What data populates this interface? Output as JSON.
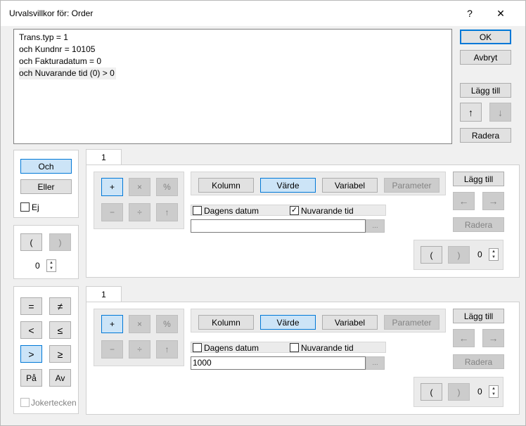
{
  "window": {
    "title": "Urvalsvillkor för: Order",
    "help": "?",
    "close": "✕"
  },
  "conditions": [
    "Trans.typ = 1",
    "och Kundnr = 10105",
    "och Fakturadatum = 0",
    "och Nuvarande tid (0) > 0"
  ],
  "right_buttons": {
    "ok": "OK",
    "cancel": "Avbryt",
    "add": "Lägg till",
    "up": "↑",
    "down": "↓",
    "delete": "Radera"
  },
  "logic": {
    "and": "Och",
    "or": "Eller",
    "not": "Ej"
  },
  "paren_group": {
    "open": "(",
    "close": ")",
    "count": "0"
  },
  "operators": {
    "eq": "=",
    "neq": "≠",
    "lt": "<",
    "lte": "≤",
    "gt": ">",
    "gte": "≥",
    "on": "På",
    "off": "Av",
    "wildcard": "Jokertecken"
  },
  "editors": [
    {
      "tab": "1",
      "ops": {
        "plus": "+",
        "times": "×",
        "percent": "%",
        "minus": "−",
        "divide": "÷",
        "up": "↑"
      },
      "types": {
        "column": "Kolumn",
        "value": "Värde",
        "variable": "Variabel",
        "parameter": "Parameter"
      },
      "today_label": "Dagens datum",
      "now_label": "Nuvarande tid",
      "now_checked": true,
      "value": "",
      "browse": "...",
      "add": "Lägg till",
      "left": "←",
      "right": "→",
      "delete": "Radera",
      "paren_open": "(",
      "paren_close": ")",
      "paren_count": "0"
    },
    {
      "tab": "1",
      "ops": {
        "plus": "+",
        "times": "×",
        "percent": "%",
        "minus": "−",
        "divide": "÷",
        "up": "↑"
      },
      "types": {
        "column": "Kolumn",
        "value": "Värde",
        "variable": "Variabel",
        "parameter": "Parameter"
      },
      "today_label": "Dagens datum",
      "now_label": "Nuvarande tid",
      "now_checked": false,
      "value": "1000",
      "browse": "...",
      "add": "Lägg till",
      "left": "←",
      "right": "→",
      "delete": "Radera",
      "paren_open": "(",
      "paren_close": ")",
      "paren_count": "0"
    }
  ]
}
